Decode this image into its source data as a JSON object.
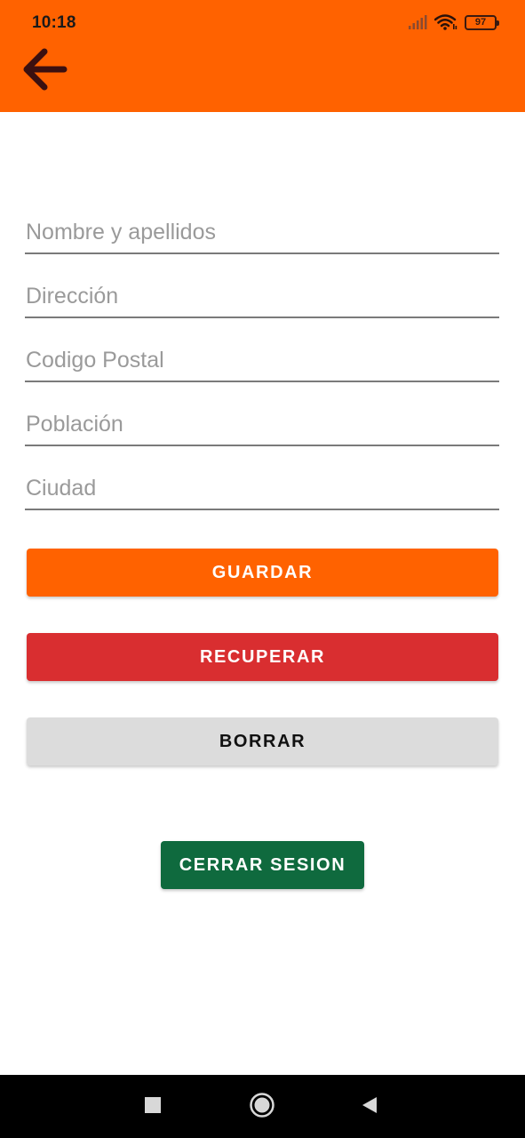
{
  "status_bar": {
    "time": "10:18",
    "battery": "97",
    "icons": [
      "signal-icon",
      "wifi-icon",
      "battery-icon"
    ]
  },
  "header": {
    "back_icon": "arrow-left-icon"
  },
  "form": {
    "fields": [
      {
        "name": "nombre",
        "placeholder": "Nombre y apellidos",
        "value": ""
      },
      {
        "name": "direccion",
        "placeholder": "Dirección",
        "value": ""
      },
      {
        "name": "codigo_postal",
        "placeholder": "Codigo Postal",
        "value": ""
      },
      {
        "name": "poblacion",
        "placeholder": "Población",
        "value": ""
      },
      {
        "name": "ciudad",
        "placeholder": "Ciudad",
        "value": ""
      }
    ]
  },
  "buttons": {
    "guardar": "GUARDAR",
    "recuperar": "RECUPERAR",
    "borrar": "BORRAR",
    "cerrar_sesion": "CERRAR SESION"
  },
  "navbar": {
    "icons": [
      "recents-icon",
      "home-icon",
      "back-icon"
    ]
  },
  "colors": {
    "accent": "#ff6200",
    "guardar_bg": "#ff6200",
    "recuperar_bg": "#d92e30",
    "borrar_bg": "#dcdcdc",
    "cerrar_bg": "#0f6a3e",
    "light_text": "#ffffff",
    "dark_text": "#111111"
  }
}
